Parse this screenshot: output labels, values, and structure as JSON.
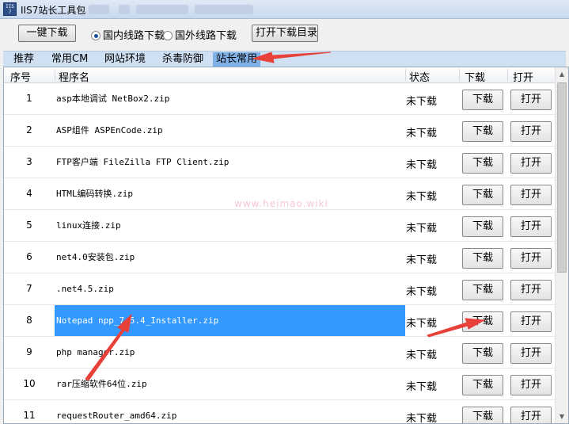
{
  "window": {
    "title": "IIS7站长工具包"
  },
  "toolbar": {
    "download_all": "一键下载",
    "radio_domestic": "国内线路下载",
    "radio_foreign": "国外线路下载",
    "open_dir": "打开下载目录"
  },
  "tabs": [
    {
      "label": "推荐"
    },
    {
      "label": "常用CM"
    },
    {
      "label": "网站环境"
    },
    {
      "label": "杀毒防御"
    },
    {
      "label": "站长常用"
    }
  ],
  "columns": {
    "num": "序号",
    "name": "程序名",
    "status": "状态",
    "download": "下载",
    "open": "打开"
  },
  "rows": [
    {
      "num": "1",
      "name": "asp本地调试 NetBox2.zip",
      "status": "未下载",
      "dl": "下载",
      "open": "打开"
    },
    {
      "num": "2",
      "name": "ASP组件 ASPEnCode.zip",
      "status": "未下载",
      "dl": "下载",
      "open": "打开"
    },
    {
      "num": "3",
      "name": "FTP客户端 FileZilla FTP Client.zip",
      "status": "未下载",
      "dl": "下载",
      "open": "打开"
    },
    {
      "num": "4",
      "name": "HTML编码转换.zip",
      "status": "未下载",
      "dl": "下载",
      "open": "打开"
    },
    {
      "num": "5",
      "name": "linux连接.zip",
      "status": "未下载",
      "dl": "下载",
      "open": "打开"
    },
    {
      "num": "6",
      "name": "net4.0安装包.zip",
      "status": "未下载",
      "dl": "下载",
      "open": "打开"
    },
    {
      "num": "7",
      "name": ".net4.5.zip",
      "status": "未下载",
      "dl": "下载",
      "open": "打开"
    },
    {
      "num": "8",
      "name": "Notepad npp_7.5.4_Installer.zip",
      "status": "未下载",
      "dl": "下载",
      "open": "打开"
    },
    {
      "num": "9",
      "name": "php manager.zip",
      "status": "未下载",
      "dl": "下载",
      "open": "打开"
    },
    {
      "num": "10",
      "name": "rar压缩软件64位.zip",
      "status": "未下载",
      "dl": "下载",
      "open": "打开"
    },
    {
      "num": "11",
      "name": "requestRouter_amd64.zip",
      "status": "未下载",
      "dl": "下载",
      "open": "打开"
    }
  ],
  "watermark": "www.heimao.wiki",
  "colors": {
    "selection": "#3399ff",
    "tab_active": "#7fb1e6",
    "tabs_bg": "#cfe0f3",
    "arrow": "#e8413a"
  }
}
